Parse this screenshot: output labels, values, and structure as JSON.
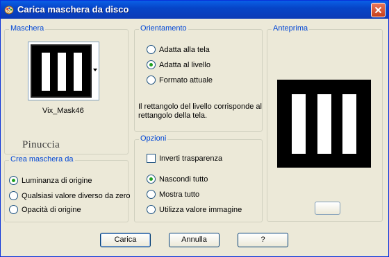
{
  "window": {
    "title": "Carica maschera da disco",
    "icon": "paint-palette-icon"
  },
  "maschera": {
    "legend": "Maschera",
    "mask_name": "Vix_Mask46",
    "watermark": "Pinuccia"
  },
  "orientamento": {
    "legend": "Orientamento",
    "options": [
      {
        "label": "Adatta alla tela",
        "selected": false
      },
      {
        "label": "Adatta al livello",
        "selected": true
      },
      {
        "label": "Formato attuale",
        "selected": false
      }
    ],
    "description_line1": "Il rettangolo del livello corrisponde al",
    "description_line2": "rettangolo della tela."
  },
  "anteprima": {
    "legend": "Anteprima"
  },
  "crea_maschera": {
    "legend": "Crea maschera da",
    "options": [
      {
        "label": "Luminanza di origine",
        "selected": true
      },
      {
        "label": "Qualsiasi valore diverso da zero",
        "selected": false
      },
      {
        "label": "Opacità di origine",
        "selected": false
      }
    ]
  },
  "opzioni": {
    "legend": "Opzioni",
    "invert_label": "Inverti trasparenza",
    "invert_checked": false,
    "options": [
      {
        "label": "Nascondi tutto",
        "selected": true
      },
      {
        "label": "Mostra tutto",
        "selected": false
      },
      {
        "label": "Utilizza valore immagine",
        "selected": false
      }
    ]
  },
  "buttons": {
    "carica": "Carica",
    "annulla": "Annulla",
    "help": "?"
  },
  "colors": {
    "titlebar": "#0a5fe6",
    "dialog_bg": "#ece9d8",
    "legend_text": "#0046d5",
    "radio_selected": "#21a121"
  }
}
